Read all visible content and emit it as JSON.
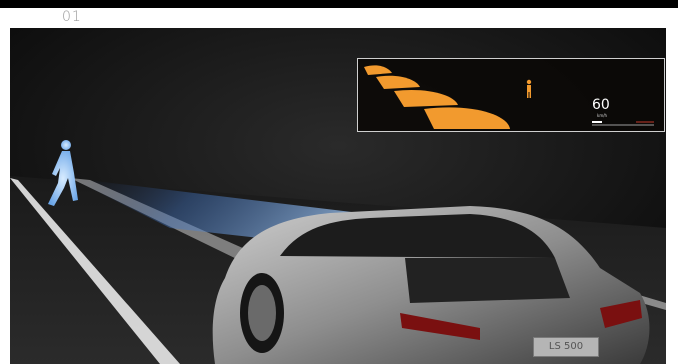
{
  "header": {
    "slide_number": "01"
  },
  "hud": {
    "speed_value": "60",
    "speed_unit": "km/h",
    "pedestrian_icon": "pedestrian-icon",
    "accent_color": "#f29a2e"
  },
  "scene": {
    "pedestrian_icon": "pedestrian-silhouette",
    "car_badge": "LS 500",
    "headlight_color": "#5a8fd6"
  }
}
